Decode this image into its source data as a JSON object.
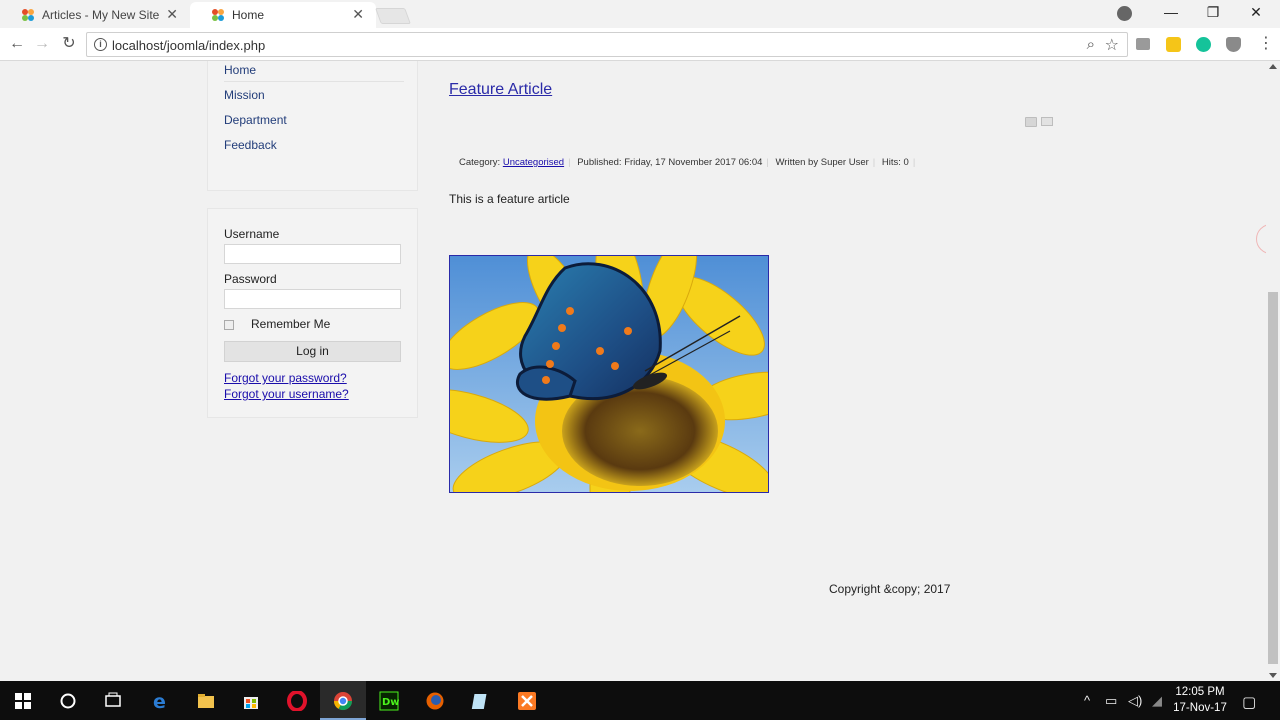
{
  "browser": {
    "tabs": [
      {
        "title": "Articles - My New Site - A",
        "close": "✕",
        "active": false
      },
      {
        "title": "Home",
        "close": "✕",
        "active": true
      }
    ],
    "url": "localhost/joomla/index.php",
    "window_controls": {
      "minimize": "—",
      "restore": "❐",
      "close": "✕"
    },
    "nav": {
      "back": "←",
      "forward": "→",
      "reload": "↻"
    }
  },
  "page": {
    "menu": [
      "Home",
      "Mission",
      "Department",
      "Feedback"
    ],
    "login": {
      "username_label": "Username",
      "password_label": "Password",
      "remember_label": "Remember Me",
      "login_button": "Log in",
      "forgot_password": "Forgot your password?",
      "forgot_username": "Forgot your username?"
    },
    "article": {
      "title": "Feature Article",
      "category_label": "Category:",
      "category": "Uncategorised",
      "published": "Published: Friday, 17 November 2017 06:04",
      "author": "Written by Super User",
      "hits": "Hits: 0",
      "body": "This is a feature article"
    },
    "footer": {
      "copyright": "Copyright &copy; 2017"
    }
  },
  "taskbar": {
    "time": "12:05 PM",
    "date": "17-Nov-17",
    "apps": [
      "start-icon",
      "cortana-icon",
      "task-view-icon",
      "edge-icon",
      "file-explorer-icon",
      "store-icon",
      "opera-icon",
      "chrome-icon",
      "dreamweaver-icon",
      "firefox-icon",
      "notepad-icon",
      "xampp-icon"
    ]
  },
  "colors": {
    "link": "#1a0dab",
    "title_link": "#2a2aa8",
    "taskbar": "#0d0d0d"
  }
}
